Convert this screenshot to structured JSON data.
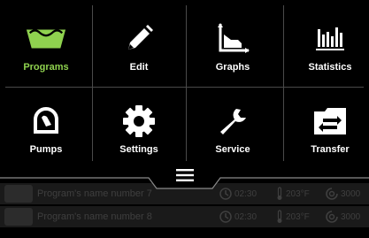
{
  "tiles": [
    {
      "label": "Programs",
      "icon": "programs-basin-icon"
    },
    {
      "label": "Edit",
      "icon": "pencil-icon"
    },
    {
      "label": "Graphs",
      "icon": "graph-icon"
    },
    {
      "label": "Statistics",
      "icon": "bar-chart-icon"
    },
    {
      "label": "Pumps",
      "icon": "pump-icon"
    },
    {
      "label": "Settings",
      "icon": "gear-icon"
    },
    {
      "label": "Service",
      "icon": "wrench-icon"
    },
    {
      "label": "Transfer",
      "icon": "folder-transfer-icon"
    }
  ],
  "colors": {
    "accent": "#8fd24f",
    "text": "#ffffff",
    "row_text": "#3f3f3f"
  },
  "programs": [
    {
      "name": "Program's name number 7",
      "time": "02:30",
      "temp": "203°F",
      "speed": "3000"
    },
    {
      "name": "Program's name number 8",
      "time": "02:30",
      "temp": "203°F",
      "speed": "3000"
    }
  ]
}
